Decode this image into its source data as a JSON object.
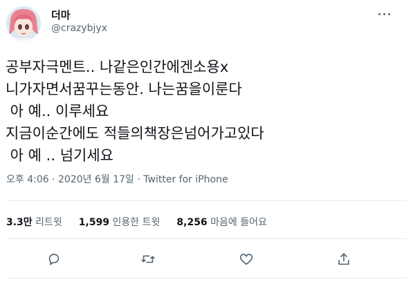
{
  "user": {
    "name": "더마",
    "handle": "@crazybjyx"
  },
  "tweet": {
    "lines": [
      "공부자극멘트.. 나같은인간에겐소용x",
      "니가자면서꿈꾸는동안. 나는꿈을이룬다",
      " 아 예.. 이루세요",
      "지금이순간에도 적들의책장은넘어가고있다",
      " 아 예 .. 넘기세요"
    ]
  },
  "meta": {
    "time": "오후 4:06",
    "separator": " · ",
    "date": "2020년 6월 17일",
    "source": "Twitter for iPhone"
  },
  "stats": {
    "retweets_count": "3.3만",
    "retweets_label": "리트윗",
    "quotes_count": "1,599",
    "quotes_label": "인용한 트윗",
    "likes_count": "8,256",
    "likes_label": "마음에 들어요"
  },
  "icons": {
    "more": "more-icon",
    "reply": "reply-icon",
    "retweet": "retweet-icon",
    "like": "heart-icon",
    "share": "share-icon"
  },
  "colors": {
    "text": "#0f1419",
    "secondary": "#536471",
    "border": "#e6ecf0"
  }
}
